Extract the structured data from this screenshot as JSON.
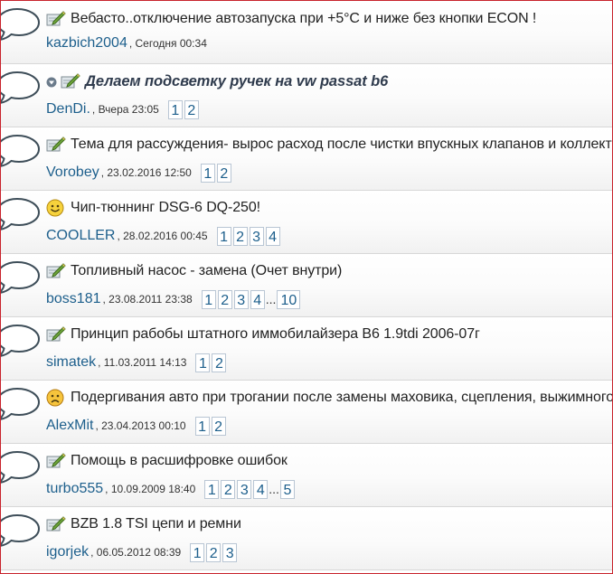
{
  "topics": [
    {
      "icon": "pencil-note-icon",
      "has_arrow": false,
      "bold": false,
      "title": "Вебасто..отключение автозапуска при +5°C и ниже без кнопки ECON !",
      "author": "kazbich2004",
      "date": ", Сегодня 00:34",
      "pages": []
    },
    {
      "icon": "pencil-note-icon",
      "has_arrow": true,
      "bold": true,
      "title": "Делаем подсветку ручек на vw passat b6",
      "author": "DenDi.",
      "date": ", Вчера 23:05",
      "pages": [
        "1",
        "2"
      ]
    },
    {
      "icon": "pencil-note-icon",
      "has_arrow": false,
      "bold": false,
      "title": "Тема для рассуждения- вырос расход после чистки впускных клапанов и коллектора",
      "author": "Vorobey",
      "date": ", 23.02.2016 12:50",
      "pages": [
        "1",
        "2"
      ]
    },
    {
      "icon": "smiley-happy-icon",
      "has_arrow": false,
      "bold": false,
      "title": "Чип-тюннинг DSG-6 DQ-250!",
      "author": "COOLLER",
      "date": ", 28.02.2016 00:45",
      "pages": [
        "1",
        "2",
        "3",
        "4"
      ]
    },
    {
      "icon": "pencil-note-icon",
      "has_arrow": false,
      "bold": false,
      "title": "Топливный насос - замена (Очет внутри)",
      "author": "boss181",
      "date": ", 23.08.2011 23:38",
      "pages": [
        "1",
        "2",
        "3",
        "4",
        "...",
        "10"
      ]
    },
    {
      "icon": "pencil-note-icon",
      "has_arrow": false,
      "bold": false,
      "title": "Принцип рабобы штатного иммобилайзера B6 1.9tdi 2006-07г",
      "author": "simatek",
      "date": ", 11.03.2011 14:13",
      "pages": [
        "1",
        "2"
      ]
    },
    {
      "icon": "smiley-sad-icon",
      "has_arrow": false,
      "bold": false,
      "title": "Подергивания авто при трогании после замены маховика, сцепления, выжимного.",
      "author": "AlexMit",
      "date": ", 23.04.2013 00:10",
      "pages": [
        "1",
        "2"
      ]
    },
    {
      "icon": "pencil-note-icon",
      "has_arrow": false,
      "bold": false,
      "title": "Помощь в расшифровке ошибок",
      "author": "turbo555",
      "date": ", 10.09.2009 18:40",
      "pages": [
        "1",
        "2",
        "3",
        "4",
        "...",
        "5"
      ]
    },
    {
      "icon": "pencil-note-icon",
      "has_arrow": false,
      "bold": false,
      "title": "BZB 1.8 TSI цепи и ремни",
      "author": "igorjek",
      "date": ", 06.05.2012 08:39",
      "pages": [
        "1",
        "2",
        "3"
      ]
    }
  ]
}
